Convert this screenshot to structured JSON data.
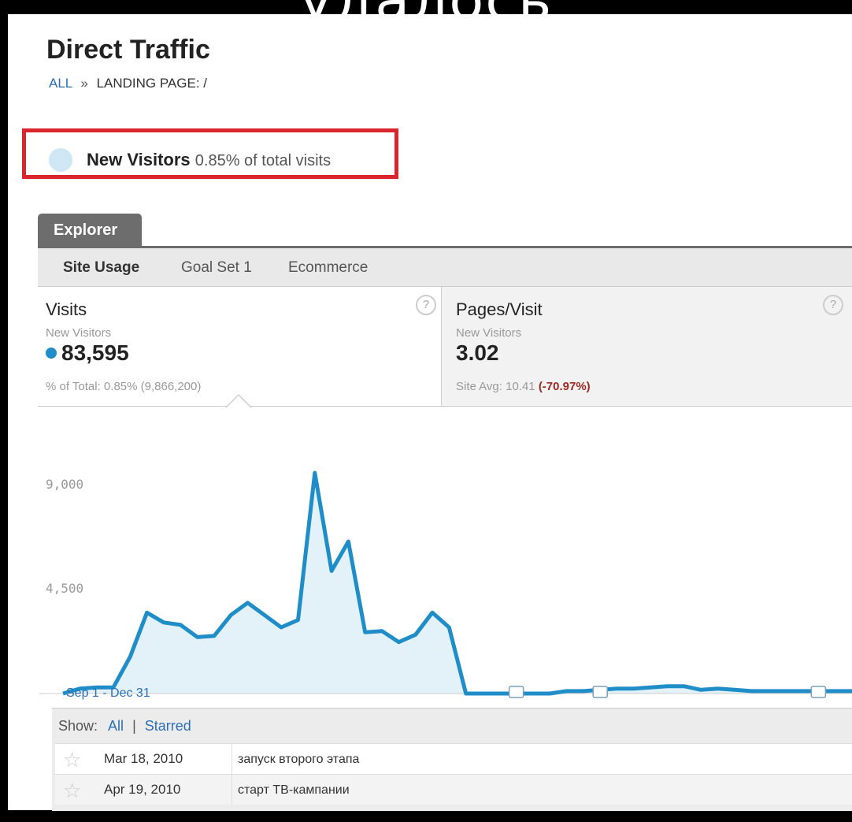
{
  "overlay": {
    "banner_text": "удалось"
  },
  "header": {
    "title": "Direct Traffic",
    "breadcrumb": {
      "root": "ALL",
      "separator": "»",
      "current": "LANDING PAGE: /"
    }
  },
  "segment": {
    "name": "New Visitors",
    "share": "0.85% of total visits"
  },
  "explorer": {
    "tab_label": "Explorer",
    "subtabs": [
      "Site Usage",
      "Goal Set 1",
      "Ecommerce"
    ]
  },
  "metrics": {
    "visits": {
      "title": "Visits",
      "segment": "New Visitors",
      "value": "83,595",
      "foot": "% of Total: 0.85% (9,866,200)"
    },
    "pages": {
      "title": "Pages/Visit",
      "segment": "New Visitors",
      "value": "3.02",
      "foot_prefix": "Site Avg: 10.41",
      "foot_change": "(-70.97%)"
    },
    "help_label": "?"
  },
  "chart_data": {
    "type": "area",
    "title": "",
    "xlabel": "Sep 1 - Dec 31",
    "ylabel": "",
    "yticks": [
      "9,000",
      "4,500"
    ],
    "ylim": [
      0,
      9000
    ],
    "series": [
      {
        "values": [
          0,
          200,
          250,
          250,
          1500,
          3300,
          2900,
          2800,
          2300,
          2350,
          3200,
          3700,
          3200,
          2700,
          3000,
          9000,
          5000,
          6200,
          2500,
          2550,
          2100,
          2400,
          3300,
          2700,
          0,
          0,
          0,
          0,
          0,
          0,
          100,
          100,
          150,
          200,
          200,
          250,
          300,
          300,
          150,
          200,
          150,
          100,
          100,
          100,
          100,
          100,
          100,
          100
        ]
      }
    ],
    "annotation_marker_indices": [
      27,
      32,
      45
    ],
    "color": "#1f8dc8",
    "fill": "#e3f1f9"
  },
  "annotations": {
    "show_label": "Show:",
    "all_label": "All",
    "divider": "|",
    "starred_label": "Starred",
    "rows": [
      {
        "date": "Mar 18, 2010",
        "note": "запуск второго этапа"
      },
      {
        "date": "Apr 19, 2010",
        "note": "старт ТВ-кампании"
      }
    ]
  }
}
